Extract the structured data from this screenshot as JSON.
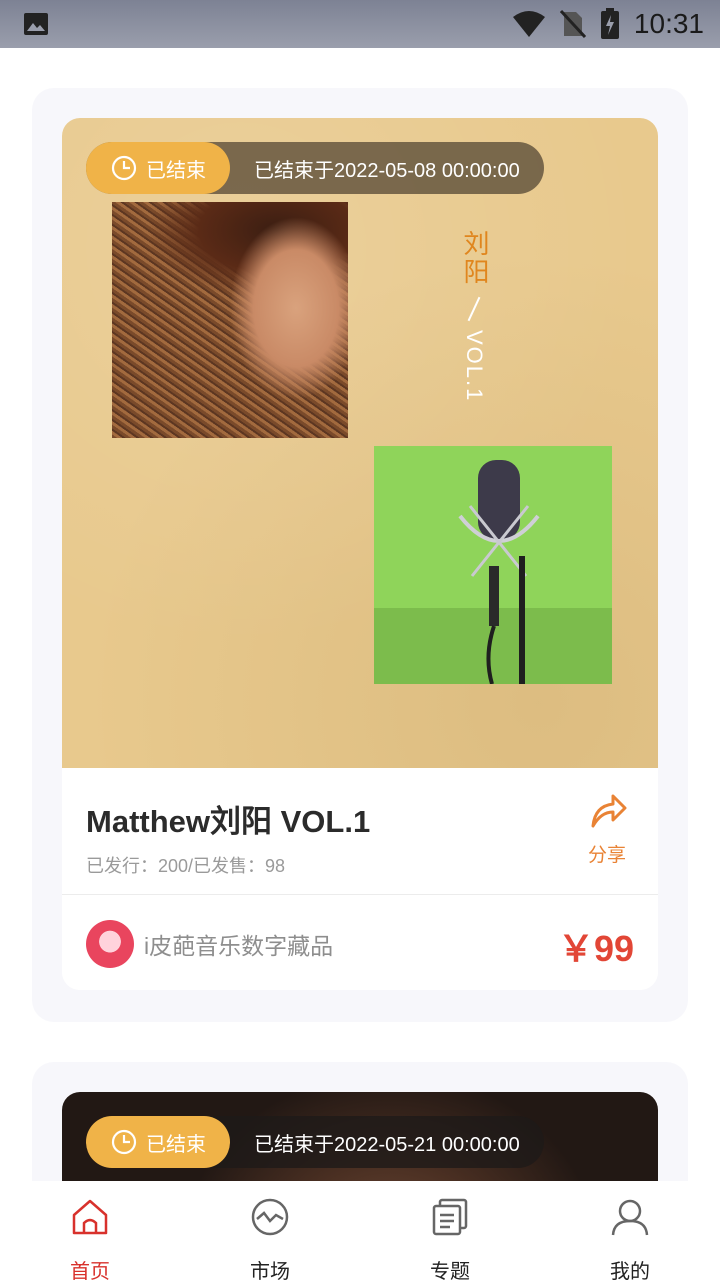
{
  "status_bar": {
    "time": "10:31"
  },
  "cards": [
    {
      "status_badge": "已结束",
      "end_text": "已结束于2022-05-08 00:00:00",
      "cover_vertical_title": "刘阳",
      "cover_vertical_vol": "VOL.1",
      "title": "Matthew刘阳 VOL.1",
      "issued_sold": "已发行：200/已发售：98",
      "share_label": "分享",
      "publisher": "i皮葩音乐数字藏品",
      "price": "￥99"
    },
    {
      "status_badge": "已结束",
      "end_text": "已结束于2022-05-21 00:00:00"
    }
  ],
  "tabbar": {
    "items": [
      {
        "label": "首页",
        "icon": "home-icon",
        "active": true
      },
      {
        "label": "市场",
        "icon": "market-icon",
        "active": false
      },
      {
        "label": "专题",
        "icon": "topics-icon",
        "active": false
      },
      {
        "label": "我的",
        "icon": "profile-icon",
        "active": false
      }
    ]
  },
  "colors": {
    "accent": "#d8312c",
    "price": "#e24636",
    "share": "#e98335",
    "badge": "#f0b348"
  }
}
